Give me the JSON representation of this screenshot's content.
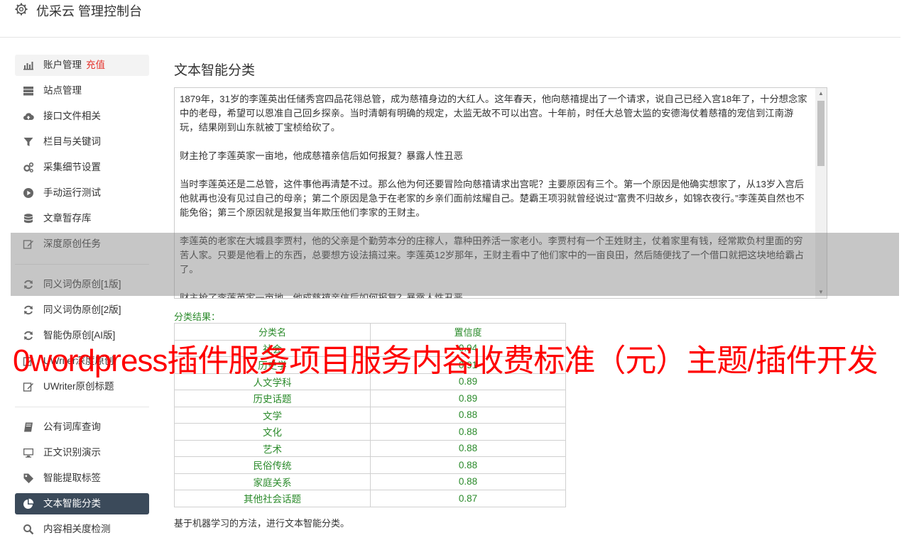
{
  "header": {
    "title": "优采云 管理控制台"
  },
  "sidebar": {
    "items": [
      {
        "label": "账户管理",
        "extra": "充值"
      },
      {
        "label": "站点管理"
      },
      {
        "label": "接口文件相关"
      },
      {
        "label": "栏目与关键词"
      },
      {
        "label": "采集细节设置"
      },
      {
        "label": "手动运行测试"
      },
      {
        "label": "文章暂存库"
      },
      {
        "label": "深度原创任务"
      },
      {
        "label": "同义词伪原创[1版]"
      },
      {
        "label": "同义词伪原创[2版]"
      },
      {
        "label": "智能伪原创[AI版]"
      },
      {
        "label": "UWriter深度原创"
      },
      {
        "label": "UWriter原创标题"
      },
      {
        "label": "公有词库查询"
      },
      {
        "label": "正文识别演示"
      },
      {
        "label": "智能提取标签"
      },
      {
        "label": "文本智能分类"
      },
      {
        "label": "内容相关度检测"
      }
    ]
  },
  "main": {
    "title": "文本智能分类",
    "text_paragraphs": [
      "1879年，31岁的李莲英出任储秀宫四品花翎总管，成为慈禧身边的大红人。这年春天，他向慈禧提出了一个请求，说自己已经入宫18年了，十分想念家中的老母，希望可以恩准自己回乡探亲。当时清朝有明确的规定，太监无故不可以出宫。十年前，时任大总管太监的安德海仗着慈禧的宠信到江南游玩，结果刚到山东就被丁宝桢给砍了。",
      "财主抢了李莲英家一亩地，他成慈禧亲信后如何报复？暴露人性丑恶",
      "当时李莲英还是二总管，这件事他再清楚不过。那么他为何还要冒险向慈禧请求出宫呢？主要原因有三个。第一个原因是他确实想家了，从13岁入宫后他就再也没有见过自己的母亲；第二个原因是急于在老家的乡亲们面前炫耀自己。楚霸王项羽就曾经说过“富贵不归故乡，如锦衣夜行。”李莲英自然也不能免俗；第三个原因就是报复当年欺压他们李家的王财主。",
      "李莲英的老家在大城县李贾村，他的父亲是个勤劳本分的庄稼人，靠种田养活一家老小。李贾村有一个王姓财主，仗着家里有钱，经常欺负村里面的穷苦人家。只要是他看上的东西，总要想方设法搞过来。李莲英12岁那年，王财主看中了他们家中的一亩良田，然后随便找了一个借口就把这块地给霸占了。",
      "财主抢了李莲英家一亩地，他成慈禧亲信后如何报复？暴露人性丑恶"
    ],
    "result_label": "分类结果：",
    "table": {
      "headers": [
        "分类名",
        "置信度"
      ],
      "rows": [
        [
          "社会",
          "0.94"
        ],
        [
          "历史学",
          "0.91"
        ],
        [
          "人文学科",
          "0.89"
        ],
        [
          "历史话题",
          "0.89"
        ],
        [
          "文学",
          "0.88"
        ],
        [
          "文化",
          "0.88"
        ],
        [
          "艺术",
          "0.88"
        ],
        [
          "民俗传统",
          "0.88"
        ],
        [
          "家庭关系",
          "0.88"
        ],
        [
          "其他社会话题",
          "0.87"
        ]
      ]
    },
    "footnote": "基于机器学习的方法，进行文本智能分类。"
  },
  "watermark": {
    "text": "0wordpress插件服务项目服务内容收费标准（元）主题/插件开发"
  },
  "colors": {
    "accent_green": "#2a8a2a",
    "active_nav": "#3b4a5a",
    "recharge_red": "#e5322b"
  }
}
